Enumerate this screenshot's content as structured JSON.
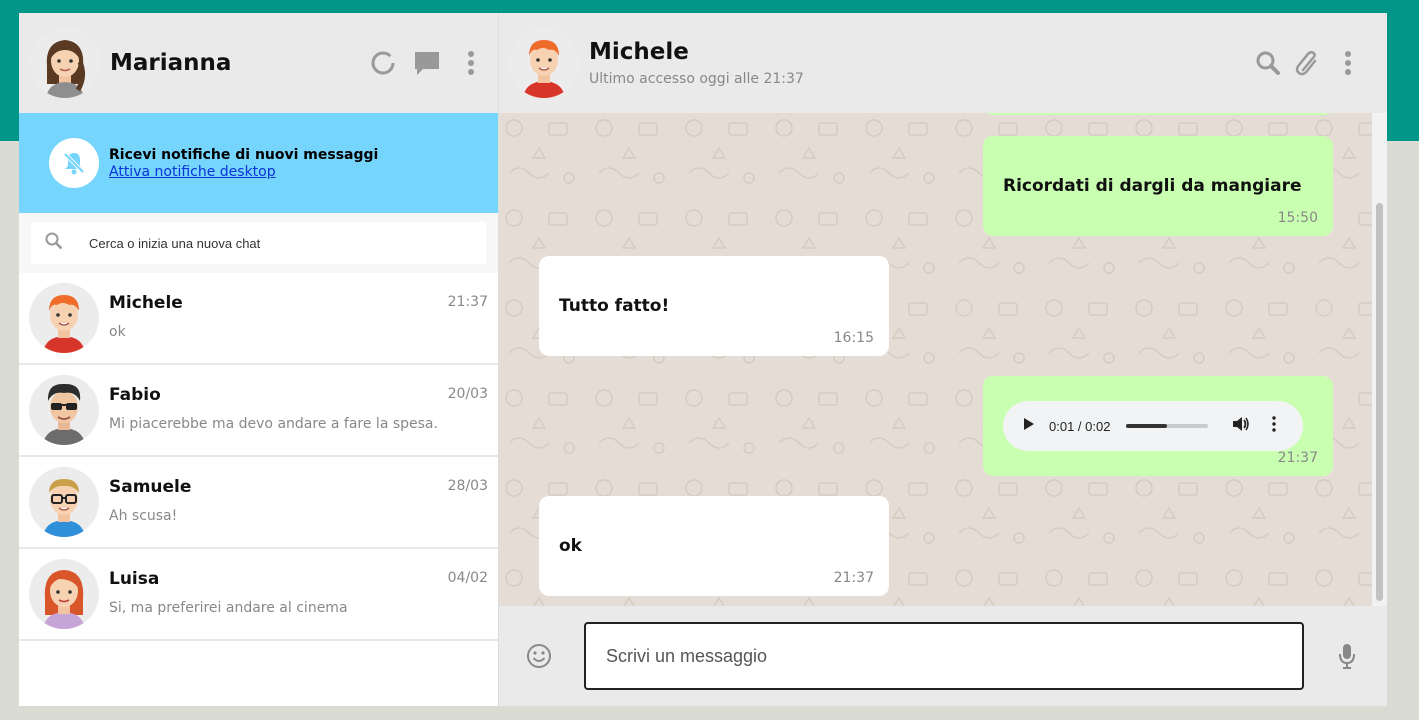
{
  "me": {
    "name": "Marianna"
  },
  "notification": {
    "title": "Ricevi notifiche di nuovi messaggi",
    "link": "Attiva notifiche desktop"
  },
  "search": {
    "placeholder": "Cerca o inizia una nuova chat"
  },
  "chats": [
    {
      "name": "Michele",
      "last_message": "ok",
      "time": "21:37"
    },
    {
      "name": "Fabio",
      "last_message": "Mi piacerebbe ma devo andare a fare la spesa.",
      "time": "20/03"
    },
    {
      "name": "Samuele",
      "last_message": "Ah scusa!",
      "time": "28/03"
    },
    {
      "name": "Luisa",
      "last_message": "Si, ma preferirei andare al cinema",
      "time": "04/02"
    }
  ],
  "conversation": {
    "contact_name": "Michele",
    "status": "Ultimo accesso oggi alle 21:37",
    "messages": [
      {
        "type": "sent",
        "text": "Ricordati di dargli da mangiare",
        "time": "15:50"
      },
      {
        "type": "received",
        "text": "Tutto fatto!",
        "time": "16:15"
      },
      {
        "type": "sent-audio",
        "audio_time": "0:01 / 0:02",
        "progress": 0.5,
        "time": "21:37"
      },
      {
        "type": "received",
        "text": "ok",
        "time": "21:37"
      }
    ]
  },
  "composer": {
    "placeholder": "Scrivi un messaggio"
  },
  "colors": {
    "brand": "#009688",
    "notification_bg": "#76d5fd",
    "sent_bubble": "#c8ffb0",
    "received_bubble": "#ffffff",
    "chat_bg": "#e5ddd5"
  }
}
